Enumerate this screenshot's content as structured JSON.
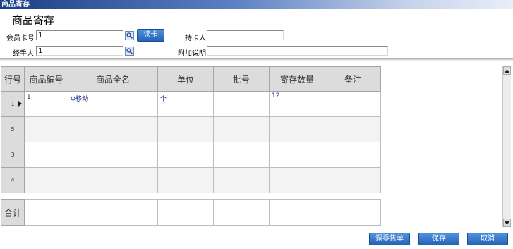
{
  "window": {
    "title": "商品寄存"
  },
  "form": {
    "heading": "商品寄存",
    "member_card_label": "会员卡号",
    "member_card_value": "1",
    "read_card_label": "读卡",
    "card_holder_label": "持卡人",
    "card_holder_value": "",
    "handler_label": "经手人",
    "handler_value": "1",
    "remark_label": "附加说明",
    "remark_value": ""
  },
  "grid": {
    "columns": [
      "行号",
      "商品编号",
      "商品全名",
      "单位",
      "批号",
      "寄存数量",
      "备注"
    ],
    "rows": [
      {
        "row_no": "1",
        "code": "1",
        "name": "Φ移动",
        "unit": "个",
        "batch": "",
        "qty": "12",
        "note": ""
      },
      {
        "row_no": "5",
        "code": "",
        "name": "",
        "unit": "",
        "batch": "",
        "qty": "",
        "note": ""
      },
      {
        "row_no": "3",
        "code": "",
        "name": "",
        "unit": "",
        "batch": "",
        "qty": "",
        "note": ""
      },
      {
        "row_no": "4",
        "code": "",
        "name": "",
        "unit": "",
        "batch": "",
        "qty": "",
        "note": ""
      }
    ],
    "total_label": "合计"
  },
  "buttons": {
    "load_doc": "调零售单",
    "save": "保存",
    "cancel": "取消"
  },
  "icons": {
    "lookup": "magnifier-lookup-icon",
    "current_row": "row-pointer-icon",
    "scroll_up": "scroll-up-icon",
    "scroll_down": "scroll-down-icon"
  },
  "colors": {
    "title_bar": "#1b3f87",
    "button": "#2f72c6",
    "grid_header": "#dcdcdc"
  }
}
